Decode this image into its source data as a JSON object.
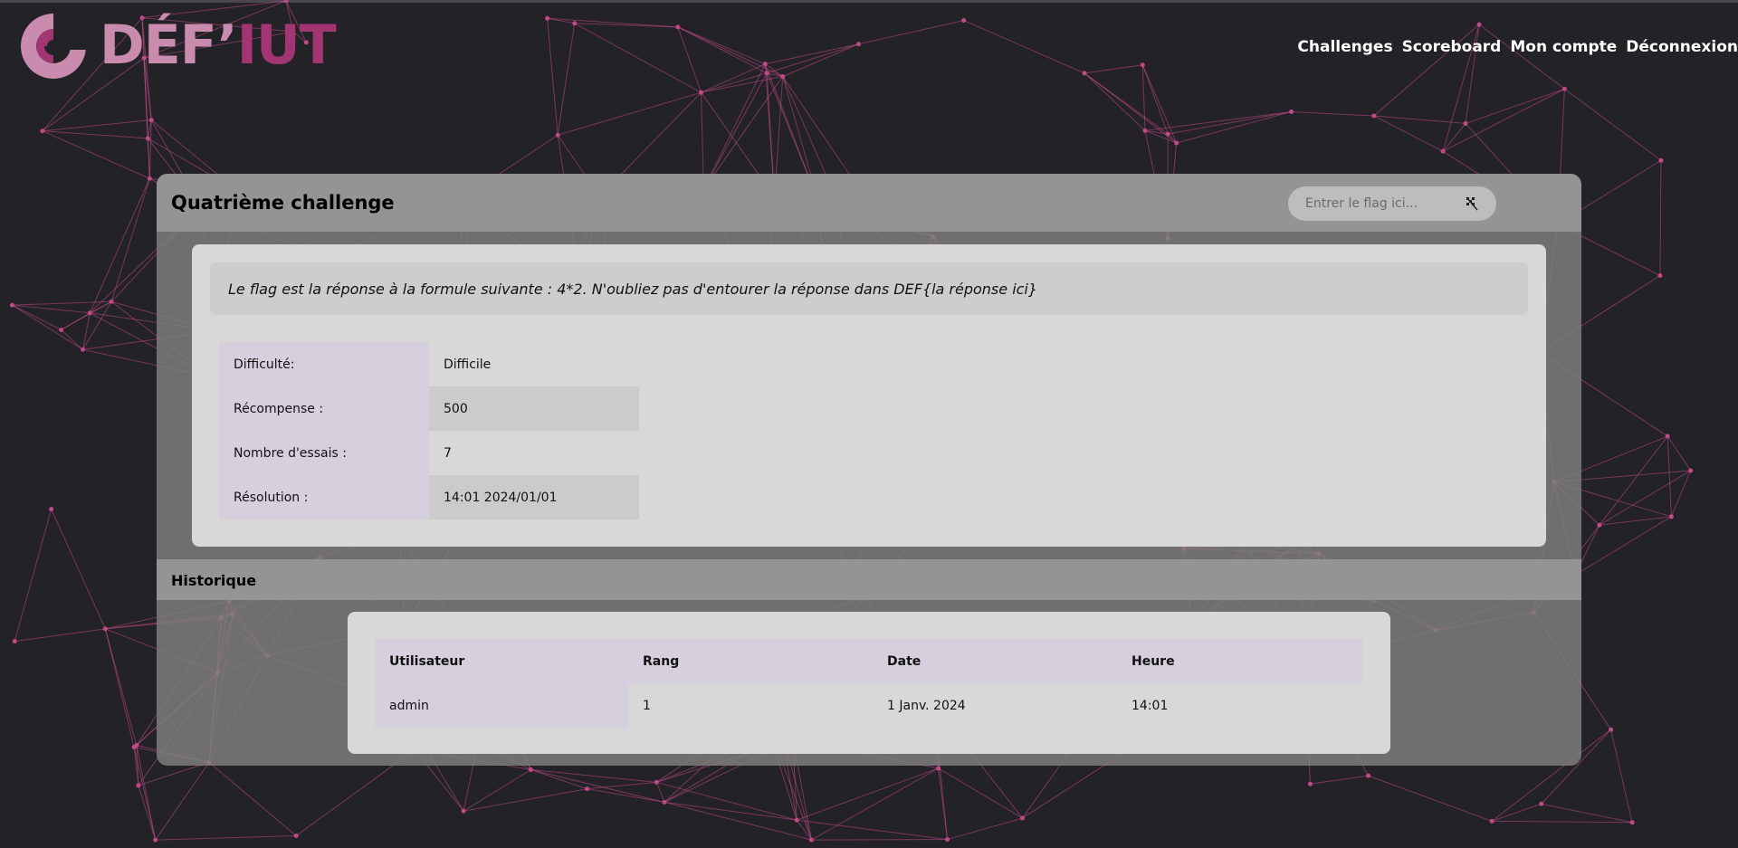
{
  "header": {
    "logo_text_part1": "DÉF’",
    "logo_text_part2": "IUT",
    "nav": [
      {
        "label": "Challenges"
      },
      {
        "label": "Scoreboard"
      },
      {
        "label": "Mon compte"
      },
      {
        "label": "Déconnexion"
      }
    ]
  },
  "challenge": {
    "title": "Quatrième challenge",
    "flag_placeholder": "Entrer le flag ici...",
    "submit_icon": "checkered-flag-icon",
    "description": "Le flag est la réponse à la formule suivante : 4*2. N'oubliez pas d'entourer la réponse dans DEF{la réponse ici}",
    "info": [
      {
        "key": "Difficulté:",
        "value": "Difficile"
      },
      {
        "key": "Récompense :",
        "value": "500"
      },
      {
        "key": "Nombre d'essais :",
        "value": "7"
      },
      {
        "key": "Résolution :",
        "value": "14:01 2024/01/01"
      }
    ]
  },
  "history": {
    "title": "Historique",
    "columns": [
      "Utilisateur",
      "Rang",
      "Date",
      "Heure"
    ],
    "rows": [
      [
        "admin",
        "1",
        "1 Janv. 2024",
        "14:01"
      ]
    ]
  },
  "colors": {
    "background": "#232226",
    "accent_light": "#c98cae",
    "accent_dark": "#a23672",
    "network_lines": "#c04a86"
  }
}
